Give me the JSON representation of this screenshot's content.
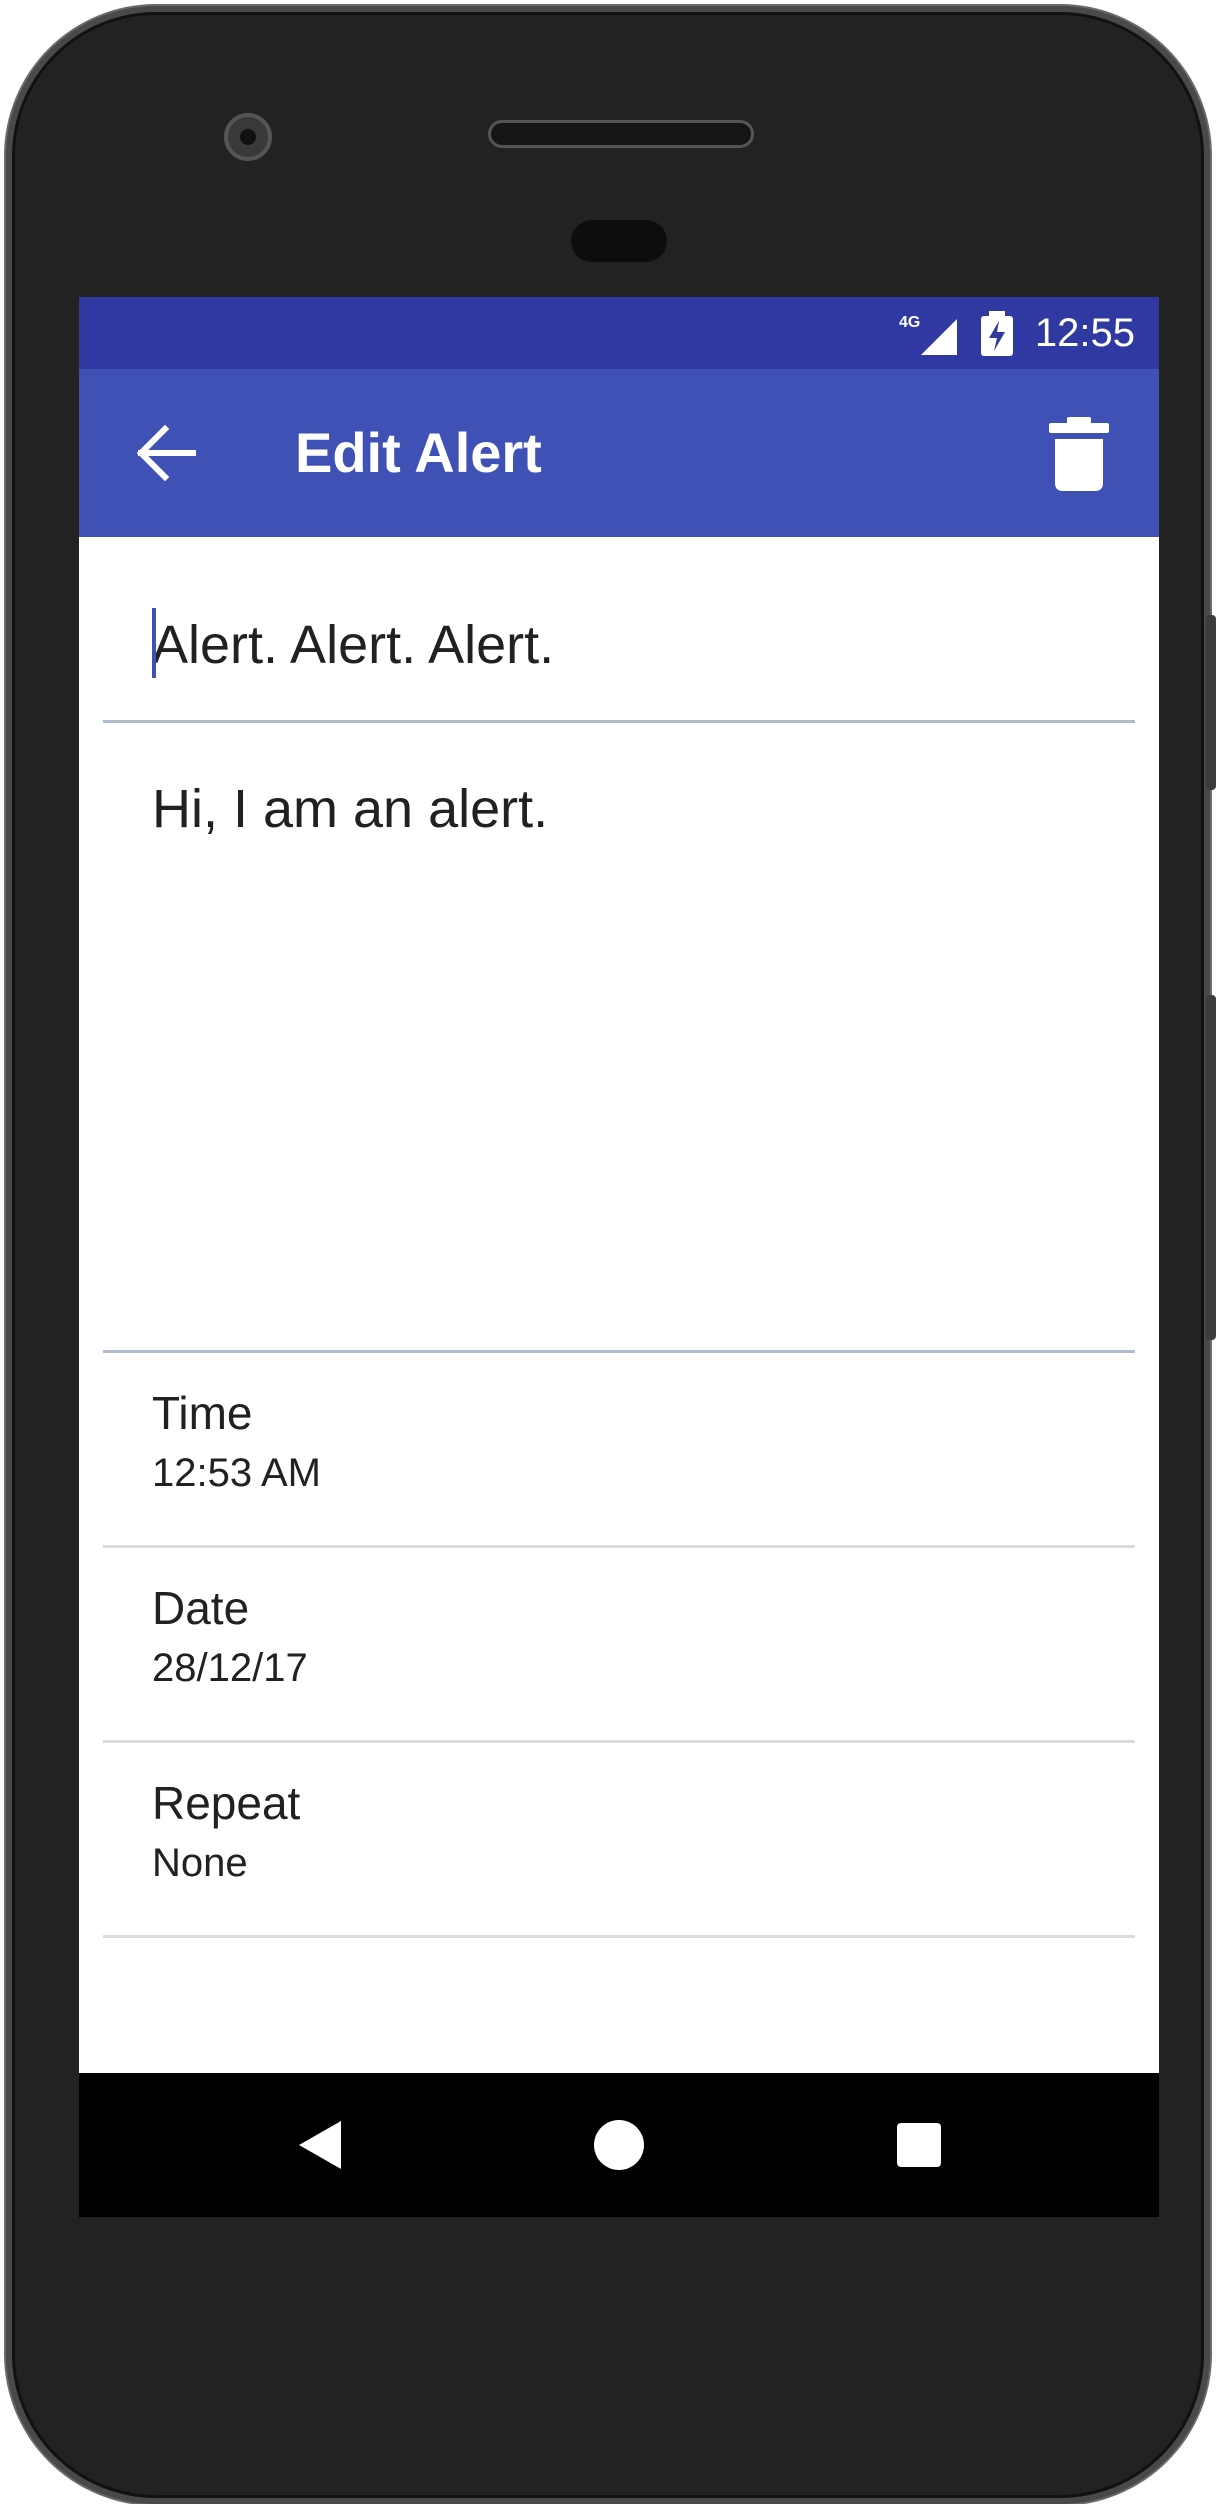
{
  "status_bar": {
    "network": "4G",
    "time": "12:55",
    "icons": [
      "signal-icon",
      "battery-charging-icon"
    ]
  },
  "app_bar": {
    "title": "Edit Alert",
    "back_icon": "arrow-back-icon",
    "delete_icon": "delete-icon"
  },
  "form": {
    "title_value": "Alert. Alert. Alert.",
    "body_value": "Hi, I am an alert."
  },
  "settings": [
    {
      "label": "Time",
      "value": "12:53 AM"
    },
    {
      "label": "Date",
      "value": "28/12/17"
    },
    {
      "label": "Repeat",
      "value": "None"
    }
  ],
  "nav_bar": {
    "icons": [
      "nav-back-icon",
      "nav-home-icon",
      "nav-recent-apps-icon"
    ]
  },
  "colors": {
    "status_bar": "#3039a2",
    "app_bar": "#3f51b5",
    "accent": "#3f51b5",
    "divider": "#dcdcdc",
    "input_underline": "#b0bccb"
  }
}
